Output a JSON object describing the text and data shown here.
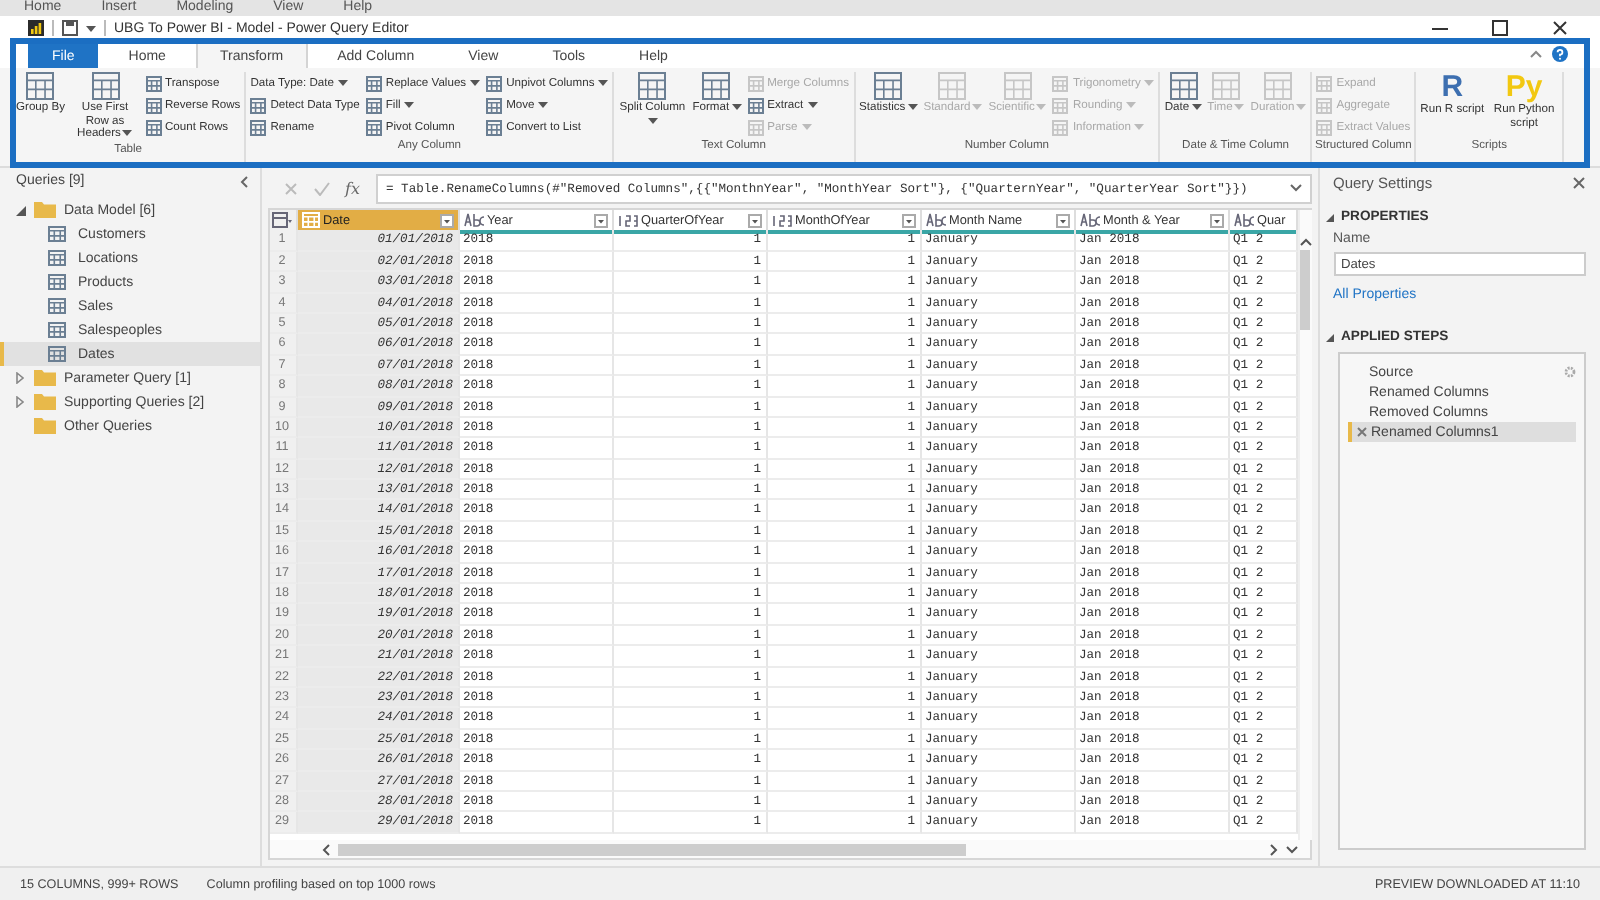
{
  "background_menu": [
    "Home",
    "Insert",
    "Modeling",
    "View",
    "Help"
  ],
  "window": {
    "title": "UBG To Power BI - Model - Power Query Editor"
  },
  "tabs": [
    {
      "label": "File",
      "kind": "file",
      "selected": false
    },
    {
      "label": "Home",
      "kind": "tab",
      "selected": false
    },
    {
      "label": "Transform",
      "kind": "tab",
      "selected": true
    },
    {
      "label": "Add Column",
      "kind": "tab",
      "selected": false
    },
    {
      "label": "View",
      "kind": "tab",
      "selected": false
    },
    {
      "label": "Tools",
      "kind": "tab",
      "selected": false
    },
    {
      "label": "Help",
      "kind": "tab",
      "selected": false
    }
  ],
  "ribbon": {
    "groups": [
      {
        "label": "Table",
        "items": [
          {
            "kind": "large",
            "label": "Group By",
            "dropdown": false,
            "disabled": false
          },
          {
            "kind": "large",
            "label": "Use First Row as Headers",
            "dropdown": true,
            "disabled": false
          },
          {
            "kind": "small",
            "label": "Transpose",
            "dropdown": false,
            "disabled": false
          },
          {
            "kind": "small",
            "label": "Reverse Rows",
            "dropdown": false,
            "disabled": false
          },
          {
            "kind": "small",
            "label": "Count Rows",
            "dropdown": false,
            "disabled": false
          }
        ]
      },
      {
        "label": "Any Column",
        "items": [
          {
            "kind": "text",
            "label": "Data Type: Date",
            "dropdown": true,
            "disabled": false
          },
          {
            "kind": "small",
            "label": "Detect Data Type",
            "dropdown": false,
            "disabled": false
          },
          {
            "kind": "small",
            "label": "Rename",
            "dropdown": false,
            "disabled": false
          },
          {
            "kind": "small",
            "label": "Replace Values",
            "dropdown": true,
            "disabled": false
          },
          {
            "kind": "small",
            "label": "Fill",
            "dropdown": true,
            "disabled": false
          },
          {
            "kind": "small",
            "label": "Pivot Column",
            "dropdown": false,
            "disabled": false
          },
          {
            "kind": "small",
            "label": "Unpivot Columns",
            "dropdown": true,
            "disabled": false
          },
          {
            "kind": "small",
            "label": "Move",
            "dropdown": true,
            "disabled": false
          },
          {
            "kind": "small",
            "label": "Convert to List",
            "dropdown": false,
            "disabled": false
          }
        ]
      },
      {
        "label": "Text Column",
        "items": [
          {
            "kind": "large",
            "label": "Split Column",
            "dropdown": true,
            "disabled": false
          },
          {
            "kind": "large",
            "label": "Format",
            "dropdown": true,
            "disabled": false
          },
          {
            "kind": "small",
            "label": "Merge Columns",
            "dropdown": false,
            "disabled": true
          },
          {
            "kind": "small",
            "label": "Extract",
            "dropdown": true,
            "disabled": false
          },
          {
            "kind": "small",
            "label": "Parse",
            "dropdown": true,
            "disabled": true
          }
        ]
      },
      {
        "label": "Number Column",
        "items": [
          {
            "kind": "large",
            "label": "Statistics",
            "dropdown": true,
            "disabled": false
          },
          {
            "kind": "large",
            "label": "Standard",
            "dropdown": true,
            "disabled": true
          },
          {
            "kind": "large",
            "label": "Scientific",
            "dropdown": true,
            "disabled": true
          },
          {
            "kind": "small",
            "label": "Trigonometry",
            "dropdown": true,
            "disabled": true
          },
          {
            "kind": "small",
            "label": "Rounding",
            "dropdown": true,
            "disabled": true
          },
          {
            "kind": "small",
            "label": "Information",
            "dropdown": true,
            "disabled": true
          }
        ]
      },
      {
        "label": "Date & Time Column",
        "items": [
          {
            "kind": "large",
            "label": "Date",
            "dropdown": true,
            "disabled": false
          },
          {
            "kind": "large",
            "label": "Time",
            "dropdown": true,
            "disabled": true
          },
          {
            "kind": "large",
            "label": "Duration",
            "dropdown": true,
            "disabled": true
          }
        ]
      },
      {
        "label": "Structured Column",
        "items": [
          {
            "kind": "small",
            "label": "Expand",
            "dropdown": false,
            "disabled": true
          },
          {
            "kind": "small",
            "label": "Aggregate",
            "dropdown": false,
            "disabled": true
          },
          {
            "kind": "small",
            "label": "Extract Values",
            "dropdown": false,
            "disabled": true
          }
        ]
      },
      {
        "label": "Scripts",
        "items": [
          {
            "kind": "script",
            "logo": "R",
            "color": "#3d6fb0",
            "label": "Run R script",
            "dropdown": false,
            "disabled": false
          },
          {
            "kind": "script",
            "logo": "Py",
            "color": "#f2c811",
            "label": "Run Python script",
            "dropdown": false,
            "disabled": false
          }
        ]
      }
    ]
  },
  "queries": {
    "title": "Queries [9]",
    "items": [
      {
        "label": "Data Model [6]",
        "kind": "folder",
        "expanded": true,
        "selected": false,
        "children": [
          {
            "label": "Customers",
            "kind": "table",
            "selected": false
          },
          {
            "label": "Locations",
            "kind": "table",
            "selected": false
          },
          {
            "label": "Products",
            "kind": "table",
            "selected": false
          },
          {
            "label": "Sales",
            "kind": "table",
            "selected": false
          },
          {
            "label": "Salespeoples",
            "kind": "table",
            "selected": false
          },
          {
            "label": "Dates",
            "kind": "table",
            "selected": true
          }
        ]
      },
      {
        "label": "Parameter Query [1]",
        "kind": "folder",
        "expanded": false,
        "selected": false
      },
      {
        "label": "Supporting Queries [2]",
        "kind": "folder",
        "expanded": false,
        "selected": false
      },
      {
        "label": "Other Queries",
        "kind": "folder",
        "selected": false
      }
    ]
  },
  "formula_bar": {
    "symbol": "fx",
    "formula": "= Table.RenameColumns(#\"Removed Columns\",{{\"MonthnYear\", \"MonthYear Sort\"}, {\"QuarternYear\", \"QuarterYear Sort\"}})"
  },
  "table": {
    "columns": [
      {
        "name": "Date",
        "kind": "date",
        "selected": true
      },
      {
        "name": "Year",
        "kind": "text",
        "selected": false
      },
      {
        "name": "QuarterOfYear",
        "kind": "number",
        "selected": false
      },
      {
        "name": "MonthOfYear",
        "kind": "number",
        "selected": false
      },
      {
        "name": "Month Name",
        "kind": "text",
        "selected": false
      },
      {
        "name": "Month & Year",
        "kind": "text",
        "selected": false
      },
      {
        "name": "Quar",
        "kind": "text",
        "selected": false
      }
    ],
    "rows": [
      {
        "number": "1",
        "cells": [
          "01/01/2018",
          "2018",
          "1",
          "1",
          "January",
          "Jan 2018",
          "Q1 2"
        ]
      },
      {
        "number": "2",
        "cells": [
          "02/01/2018",
          "2018",
          "1",
          "1",
          "January",
          "Jan 2018",
          "Q1 2"
        ]
      },
      {
        "number": "3",
        "cells": [
          "03/01/2018",
          "2018",
          "1",
          "1",
          "January",
          "Jan 2018",
          "Q1 2"
        ]
      },
      {
        "number": "4",
        "cells": [
          "04/01/2018",
          "2018",
          "1",
          "1",
          "January",
          "Jan 2018",
          "Q1 2"
        ]
      },
      {
        "number": "5",
        "cells": [
          "05/01/2018",
          "2018",
          "1",
          "1",
          "January",
          "Jan 2018",
          "Q1 2"
        ]
      },
      {
        "number": "6",
        "cells": [
          "06/01/2018",
          "2018",
          "1",
          "1",
          "January",
          "Jan 2018",
          "Q1 2"
        ]
      },
      {
        "number": "7",
        "cells": [
          "07/01/2018",
          "2018",
          "1",
          "1",
          "January",
          "Jan 2018",
          "Q1 2"
        ]
      },
      {
        "number": "8",
        "cells": [
          "08/01/2018",
          "2018",
          "1",
          "1",
          "January",
          "Jan 2018",
          "Q1 2"
        ]
      },
      {
        "number": "9",
        "cells": [
          "09/01/2018",
          "2018",
          "1",
          "1",
          "January",
          "Jan 2018",
          "Q1 2"
        ]
      },
      {
        "number": "10",
        "cells": [
          "10/01/2018",
          "2018",
          "1",
          "1",
          "January",
          "Jan 2018",
          "Q1 2"
        ]
      },
      {
        "number": "11",
        "cells": [
          "11/01/2018",
          "2018",
          "1",
          "1",
          "January",
          "Jan 2018",
          "Q1 2"
        ]
      },
      {
        "number": "12",
        "cells": [
          "12/01/2018",
          "2018",
          "1",
          "1",
          "January",
          "Jan 2018",
          "Q1 2"
        ]
      },
      {
        "number": "13",
        "cells": [
          "13/01/2018",
          "2018",
          "1",
          "1",
          "January",
          "Jan 2018",
          "Q1 2"
        ]
      },
      {
        "number": "14",
        "cells": [
          "14/01/2018",
          "2018",
          "1",
          "1",
          "January",
          "Jan 2018",
          "Q1 2"
        ]
      },
      {
        "number": "15",
        "cells": [
          "15/01/2018",
          "2018",
          "1",
          "1",
          "January",
          "Jan 2018",
          "Q1 2"
        ]
      },
      {
        "number": "16",
        "cells": [
          "16/01/2018",
          "2018",
          "1",
          "1",
          "January",
          "Jan 2018",
          "Q1 2"
        ]
      },
      {
        "number": "17",
        "cells": [
          "17/01/2018",
          "2018",
          "1",
          "1",
          "January",
          "Jan 2018",
          "Q1 2"
        ]
      },
      {
        "number": "18",
        "cells": [
          "18/01/2018",
          "2018",
          "1",
          "1",
          "January",
          "Jan 2018",
          "Q1 2"
        ]
      },
      {
        "number": "19",
        "cells": [
          "19/01/2018",
          "2018",
          "1",
          "1",
          "January",
          "Jan 2018",
          "Q1 2"
        ]
      },
      {
        "number": "20",
        "cells": [
          "20/01/2018",
          "2018",
          "1",
          "1",
          "January",
          "Jan 2018",
          "Q1 2"
        ]
      },
      {
        "number": "21",
        "cells": [
          "21/01/2018",
          "2018",
          "1",
          "1",
          "January",
          "Jan 2018",
          "Q1 2"
        ]
      },
      {
        "number": "22",
        "cells": [
          "22/01/2018",
          "2018",
          "1",
          "1",
          "January",
          "Jan 2018",
          "Q1 2"
        ]
      },
      {
        "number": "23",
        "cells": [
          "23/01/2018",
          "2018",
          "1",
          "1",
          "January",
          "Jan 2018",
          "Q1 2"
        ]
      },
      {
        "number": "24",
        "cells": [
          "24/01/2018",
          "2018",
          "1",
          "1",
          "January",
          "Jan 2018",
          "Q1 2"
        ]
      },
      {
        "number": "25",
        "cells": [
          "25/01/2018",
          "2018",
          "1",
          "1",
          "January",
          "Jan 2018",
          "Q1 2"
        ]
      },
      {
        "number": "26",
        "cells": [
          "26/01/2018",
          "2018",
          "1",
          "1",
          "January",
          "Jan 2018",
          "Q1 2"
        ]
      },
      {
        "number": "27",
        "cells": [
          "27/01/2018",
          "2018",
          "1",
          "1",
          "January",
          "Jan 2018",
          "Q1 2"
        ]
      },
      {
        "number": "28",
        "cells": [
          "28/01/2018",
          "2018",
          "1",
          "1",
          "January",
          "Jan 2018",
          "Q1 2"
        ]
      },
      {
        "number": "29",
        "cells": [
          "29/01/2018",
          "2018",
          "1",
          "1",
          "January",
          "Jan 2018",
          "Q1 2"
        ]
      }
    ]
  },
  "settings": {
    "title": "Query Settings",
    "properties_heading": "PROPERTIES",
    "name_label": "Name",
    "name_value": "Dates",
    "all_properties": "All Properties",
    "steps_heading": "APPLIED STEPS",
    "steps": [
      {
        "label": "Source",
        "selected": false,
        "settings": true
      },
      {
        "label": "Renamed Columns",
        "selected": false,
        "settings": false
      },
      {
        "label": "Removed Columns",
        "selected": false,
        "settings": false
      },
      {
        "label": "Renamed Columns1",
        "selected": true,
        "settings": false
      }
    ]
  },
  "status_bar": {
    "left": [
      "15 COLUMNS, 999+ ROWS",
      "Column profiling based on top 1000 rows"
    ],
    "right": "PREVIEW DOWNLOADED AT 11:10"
  }
}
